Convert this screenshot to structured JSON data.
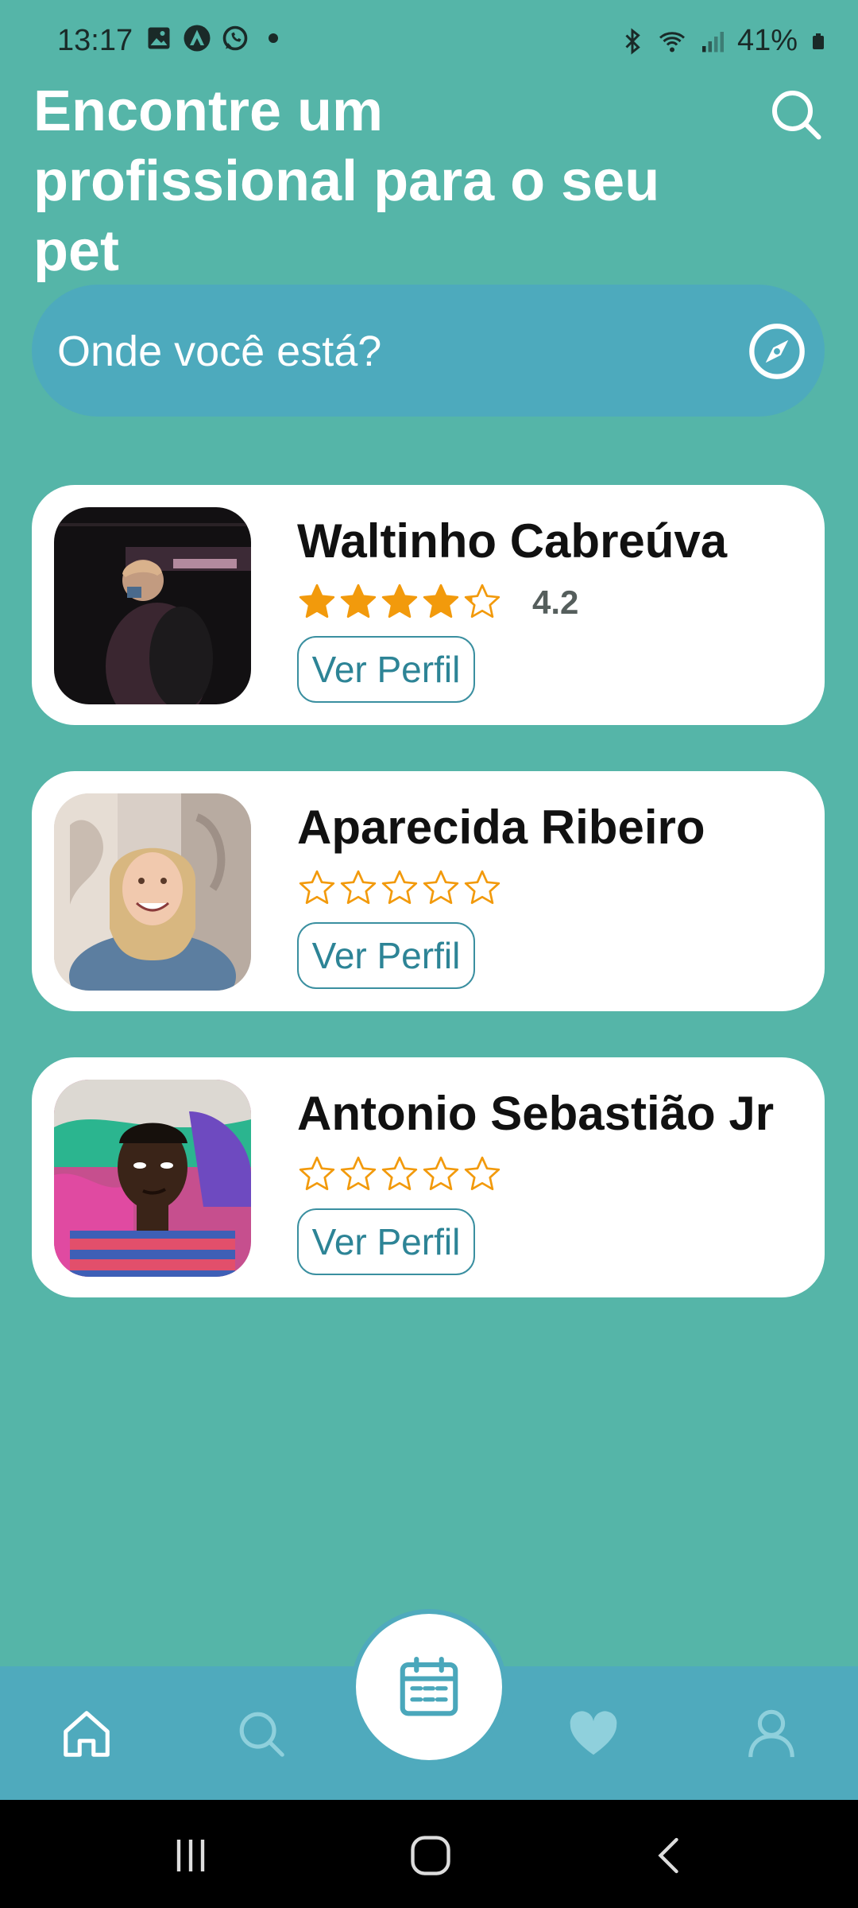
{
  "status_bar": {
    "time": "13:17",
    "battery": "41%",
    "left_icons": [
      "image-icon",
      "nav-app-icon",
      "whatsapp-icon",
      "dot-icon"
    ],
    "right_icons": [
      "bluetooth-icon",
      "wifi-icon",
      "signal-icon",
      "battery-icon"
    ]
  },
  "header": {
    "title": "Encontre um profissional para o seu pet",
    "search_icon": "search-icon"
  },
  "location": {
    "placeholder": "Onde você está?",
    "icon": "compass-icon"
  },
  "professionals": [
    {
      "name": "Waltinho Cabreúva",
      "rating": 4.2,
      "rating_label": "4.2",
      "button": "Ver Perfil"
    },
    {
      "name": "Aparecida Ribeiro",
      "rating": 0,
      "rating_label": "",
      "button": "Ver Perfil"
    },
    {
      "name": "Antonio Sebastião Jr",
      "rating": 0,
      "rating_label": "",
      "button": "Ver Perfil"
    }
  ],
  "bottom_nav": {
    "items": [
      "home-icon",
      "search-icon",
      "calendar-icon",
      "heart-icon",
      "profile-icon"
    ],
    "active": "calendar-icon"
  },
  "colors": {
    "background": "#55b5a8",
    "search_bar": "#4daabd",
    "nav_bar": "#4faabd",
    "star": "#f29a0c",
    "button_text": "#2d8496"
  }
}
